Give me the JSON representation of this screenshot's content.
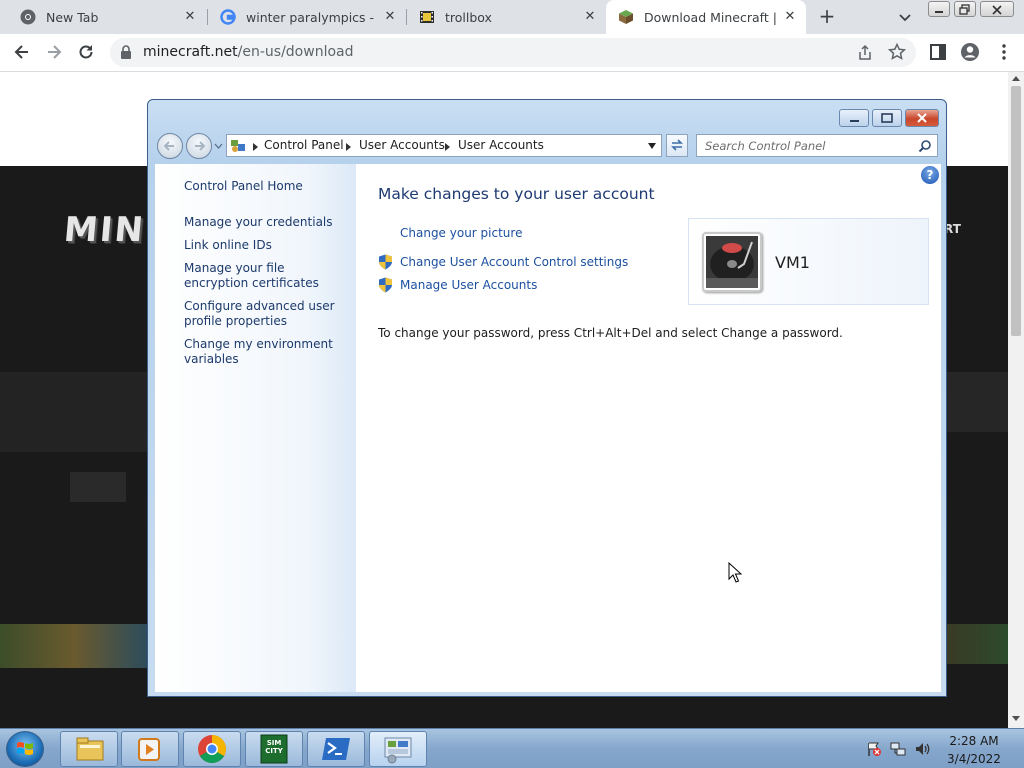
{
  "browser": {
    "tabs": [
      {
        "title": "New Tab",
        "favicon": "chrome-icon",
        "active": false
      },
      {
        "title": "winter paralympics - Goo",
        "favicon": "google-icon",
        "active": false
      },
      {
        "title": "trollbox",
        "favicon": "film-icon",
        "active": false
      },
      {
        "title": "Download Minecraft | Mi",
        "favicon": "minecraft-grass-block-icon",
        "active": true
      }
    ],
    "close_glyph": "✕",
    "new_tab_glyph": "+",
    "url_host": "minecraft.net",
    "url_path": "/en-us/download"
  },
  "webpage": {
    "logo_text": "MINE",
    "nav_text": "RT"
  },
  "control_panel": {
    "breadcrumbs": [
      "Control Panel",
      "User Accounts",
      "User Accounts"
    ],
    "search_placeholder": "Search Control Panel",
    "left_links": [
      "Control Panel Home",
      "Manage your credentials",
      "Link online IDs",
      "Manage your file encryption certificates",
      "Configure advanced user profile properties",
      "Change my environment variables"
    ],
    "heading": "Make changes to your user account",
    "tasks": [
      {
        "label": "Change your picture",
        "icon": null
      },
      {
        "label": "Change User Account Control settings",
        "icon": "uac-shield-icon"
      },
      {
        "label": "Manage User Accounts",
        "icon": "uac-shield-icon"
      }
    ],
    "account_name": "VM1",
    "password_note": "To change your password, press Ctrl+Alt+Del and select Change a password.",
    "help_glyph": "?"
  },
  "taskbar": {
    "pinned": [
      "explorer-icon",
      "media-player-icon",
      "chrome-icon",
      "simcity-icon",
      "powershell-icon",
      "control-panel-icon"
    ],
    "simcity_label": "SIM CITY",
    "time": "2:28 AM",
    "date": "3/4/2022"
  },
  "colors": {
    "link": "#1c50a0",
    "heading": "#1e3a72",
    "taskbar": "#86a7cc"
  }
}
